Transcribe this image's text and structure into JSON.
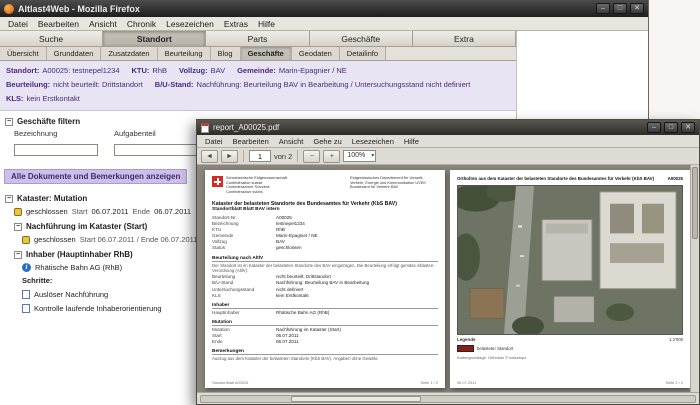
{
  "ui": {
    "expander_glyph": "−",
    "check_glyph": "✓",
    "min_glyph": "–",
    "max_glyph": "□",
    "close_glyph": "✕",
    "info_glyph": "i",
    "prev_glyph": "◄",
    "next_glyph": "►",
    "zoom_out_glyph": "−",
    "zoom_in_glyph": "+"
  },
  "colors": {
    "accent_purple": "#4b2a7b",
    "lavender_bar": "#cdc0e8",
    "info_panel_bg": "#e9e4f3",
    "check_green": "#3aa13a",
    "swiss_red": "#d52b1e",
    "legend_maroon": "#7e2420"
  },
  "firefox": {
    "title": "Altlast4Web - Mozilla Firefox",
    "menu": [
      "Datei",
      "Bearbeiten",
      "Ansicht",
      "Chronik",
      "Lesezeichen",
      "Extras",
      "Hilfe"
    ],
    "nav_tabs": [
      "Suche",
      "Standort",
      "Parts",
      "Geschäfte",
      "Extra"
    ],
    "sub_tabs": [
      "Übersicht",
      "Grunddaten",
      "Zusatzdaten",
      "Beurteilung",
      "Blog",
      "Geschäfte",
      "Geodaten",
      "Detailinfo"
    ],
    "info": {
      "standort_label": "Standort:",
      "standort_value": "A00025: testnepel1234",
      "ktu_label": "KTU:",
      "ktu_value": "RhB",
      "vollzug_label": "Vollzug:",
      "vollzug_value": "BAV",
      "gemeinde_label": "Gemeinde:",
      "gemeinde_value": "Marin-Epagnier / NE",
      "beurteilung_label": "Beurteilung:",
      "beurteilung_value": "nicht beurteilt: Drittstandort",
      "bu_label": "B/U-Stand:",
      "bu_value": "Nachführung: Beurteilung BAV in Bearbeitung / Untersuchungsstand nicht definiert",
      "kls_label": "KLS:",
      "kls_value": "kein Erstkontakt"
    },
    "filter": {
      "header": "Geschäfte filtern",
      "field1_label": "Bezeichnung",
      "field1_value": "",
      "field2_label": "Aufgabenteil",
      "field2_value": ""
    },
    "show_all_link": "Alle Dokumente und Bemerkungen anzeigen",
    "kataster": {
      "header": "Kataster: Mutation",
      "status1": {
        "state": "geschlossen",
        "start_label": "Start",
        "start": "06.07.2011",
        "ende_label": "Ende",
        "ende": "06.07.2011"
      },
      "sub_header": "Nachführung im Kataster (Start)",
      "status2": {
        "state": "geschlossen",
        "text": "Start 06.07.2011 / Ende 06.07.2011"
      },
      "inhaber_header": "Inhaber (Hauptinhaber RhB)",
      "inhaber_value": "Rhätische Bahn AG (RhB)",
      "schritte_label": "Schritte:",
      "schritt1": "Auslöser Nachführung",
      "schritt2": "Kontrolle laufende Inhaberorientierung"
    }
  },
  "viewer": {
    "title": "report_A00025.pdf",
    "menu": [
      "Datei",
      "Bearbeiten",
      "Ansicht",
      "Gehe zu",
      "Lesezeichen",
      "Hilfe"
    ],
    "toolbar": {
      "page_value": "1",
      "page_of_label": "von 2",
      "zoom_value": "100%"
    },
    "page1": {
      "logo_lines": [
        "Schweizerische Eidgenossenschaft",
        "Confédération suisse",
        "Confederazione Svizzera",
        "Confederaziun svizra"
      ],
      "office_lines": [
        "Eidgenössisches Departement für Umwelt,",
        "Verkehr, Energie und Kommunikation UVEK",
        "Bundesamt für Verkehr BAV"
      ],
      "title1": "Kataster der belasteten Standorte des Bundesamtes für Verkehr (KbS BAV)",
      "title2": "Standortblatt Blatt BAV intern",
      "rows": [
        {
          "l": "Standort-Nr.",
          "v": "A00025"
        },
        {
          "l": "Bezeichnung",
          "v": "testnepel1234"
        },
        {
          "l": "KTU",
          "v": "RhB"
        },
        {
          "l": "Gemeinde",
          "v": "Marin-Epagnier / NE"
        },
        {
          "l": "Vollzug",
          "v": "BAV"
        },
        {
          "l": "Status",
          "v": "geschlossen"
        },
        {
          "l": "Beurteilung",
          "v": "nicht beurteilt: Drittstandort"
        },
        {
          "l": "B/U-Stand",
          "v": "Nachführung: Beurteilung BAV in Bearbeitung"
        },
        {
          "l": "Untersuchungsstand",
          "v": "nicht definiert"
        },
        {
          "l": "KLS",
          "v": "kein Erstkontakt"
        },
        {
          "l": "Hauptinhaber",
          "v": "Rhätische Bahn AG (RhB)"
        },
        {
          "l": "Mutation",
          "v": "Nachführung im Kataster (Start)"
        },
        {
          "l": "Start",
          "v": "06.07.2011"
        },
        {
          "l": "Ende",
          "v": "06.07.2011"
        }
      ],
      "sec1": "Beurteilung nach AltlV",
      "para1": "Der Standort ist im Kataster der belasteten Standorte des BAV eingetragen. Die Beurteilung erfolgt gemäss Altlasten-Verordnung (AltlV).",
      "sec2": "Inhaber",
      "sec3": "Mutation",
      "sec4": "Bemerkungen",
      "para4": "Auszug aus dem Kataster der belasteten Standorte (KbS BAV). Angaben ohne Gewähr.",
      "footer_left": "Standortblatt A00025",
      "footer_right": "Seite 1 / 2"
    },
    "page2": {
      "heading": "Orthofoto aus dem Kataster der belasteten Standorte des Bundesamtes für Verkehr (KbS BAV)",
      "heading_right": "A00025",
      "legend_title": "Legende",
      "scale": "1:2'000",
      "legend_item": "belasteter Standort",
      "source": "Kartengrundlage: Orthofoto © swisstopo",
      "footer_left": "06.07.2011",
      "footer_right": "Seite 2 / 2"
    }
  }
}
